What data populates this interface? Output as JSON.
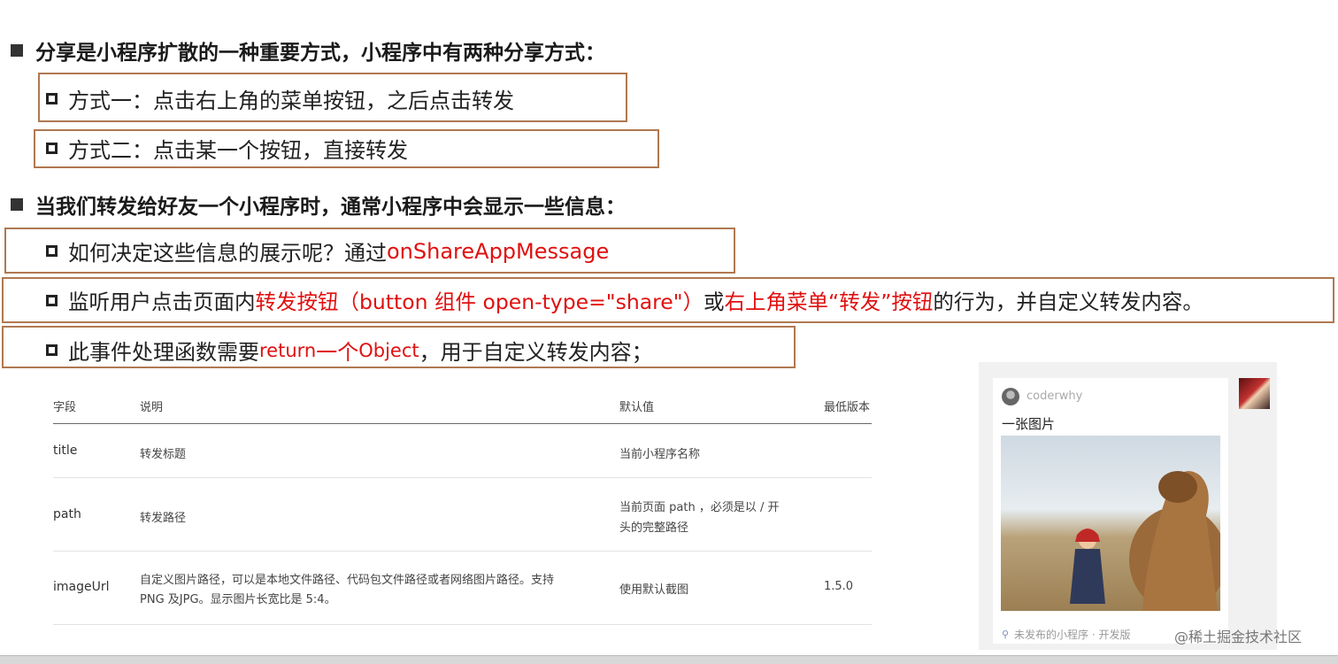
{
  "bullets": [
    {
      "text": "分享是小程序扩散的一种重要方式，小程序中有两种分享方式："
    },
    {
      "text": "当我们转发给好友一个小程序时，通常小程序中会显示一些信息："
    }
  ],
  "subs": {
    "way1": "方式一：点击右上角的菜单按钮，之后点击转发",
    "way2": "方式二：点击某一个按钮，直接转发",
    "how_prefix": "如何决定这些信息的展示呢？通过 ",
    "how_api": "onShareAppMessage",
    "listen_1": "监听用户点击页面内",
    "listen_red1": "转发按钮（button 组件 open-type=\"share\"）",
    "listen_2": "或",
    "listen_red2": "右上角菜单“转发”按钮",
    "listen_3": "的行为，并自定义转发内容。",
    "handler_1": "此事件处理函数需要 ",
    "handler_red1": "return",
    "handler_red2": " 一个 ",
    "handler_red3": "Object",
    "handler_2": "，用于自定义转发内容；"
  },
  "table": {
    "headers": [
      "字段",
      "说明",
      "默认值",
      "最低版本"
    ],
    "rows": [
      {
        "field": "title",
        "desc": "转发标题",
        "default": "当前小程序名称",
        "version": ""
      },
      {
        "field": "path",
        "desc": "转发路径",
        "default_l1": "当前页面 path ，必须是以 / 开",
        "default_l2": "头的完整路径",
        "version": ""
      },
      {
        "field": "imageUrl",
        "desc_l1": "自定义图片路径，可以是本地文件路径、代码包文件路径或者网络图片路径。支持",
        "desc_l2": "PNG 及JPG。显示图片长宽比是 5:4。",
        "default": "使用默认截图",
        "version": "1.5.0"
      }
    ]
  },
  "card": {
    "username": "coderwhy",
    "caption": "一张图片",
    "footer": "未发布的小程序 · 开发版"
  },
  "watermark": "@稀土掘金技术社区"
}
